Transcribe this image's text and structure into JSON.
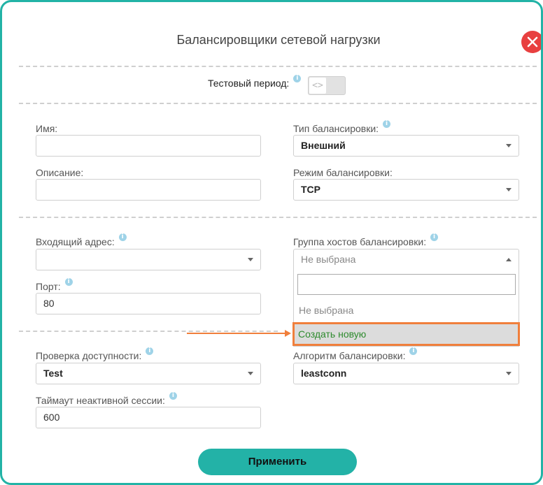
{
  "dialog": {
    "title": "Балансировщики сетевой нагрузки",
    "close_icon": "close-icon"
  },
  "trial": {
    "label": "Тестовый период:",
    "toggle_state": "off",
    "toggle_glyph": "<>"
  },
  "fields": {
    "name_label": "Имя:",
    "name_value": "",
    "description_label": "Описание:",
    "description_value": "",
    "balancing_type_label": "Тип балансировки:",
    "balancing_type_value": "Внешний",
    "balancing_mode_label": "Режим балансировки:",
    "balancing_mode_value": "TCP",
    "incoming_address_label": "Входящий адрес:",
    "incoming_address_value": "",
    "port_label": "Порт:",
    "port_value": "80",
    "host_group_label": "Группа хостов балансировки:",
    "host_group_value": "Не выбрана",
    "availability_check_label": "Проверка доступности:",
    "availability_check_value": "Test",
    "algorithm_label": "Алгоритм балансировки:",
    "algorithm_value": "leastconn",
    "timeout_label": "Таймаут неактивной сессии:",
    "timeout_value": "600"
  },
  "host_group_dropdown": {
    "search_value": "",
    "options": [
      "Не выбрана",
      "Создать новую"
    ]
  },
  "info_icon": "i",
  "apply_label": "Применить",
  "colors": {
    "accent": "#23b2a7",
    "close": "#e84040",
    "highlight": "#f07f3c",
    "create_option": "#2e8b2e"
  }
}
